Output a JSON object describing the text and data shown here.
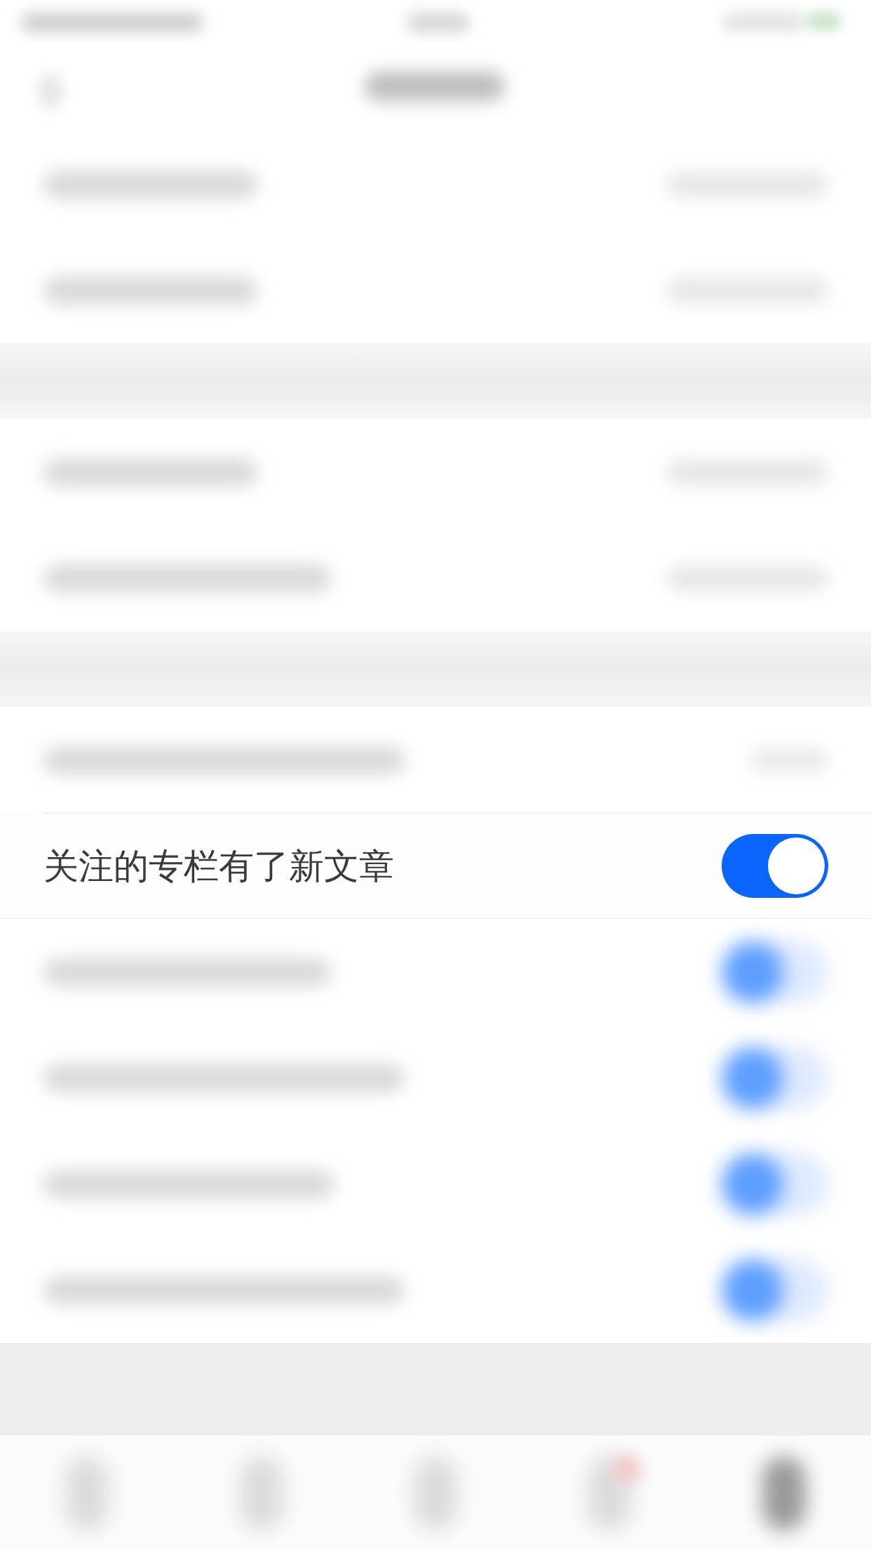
{
  "sections": [
    {
      "rows": [
        {
          "kind": "value",
          "blurred": true
        },
        {
          "kind": "value",
          "blurred": true
        }
      ]
    },
    {
      "rows": [
        {
          "kind": "value",
          "blurred": true
        },
        {
          "kind": "value",
          "blurred": true
        }
      ]
    },
    {
      "rows": [
        {
          "kind": "value",
          "blurred": true
        },
        {
          "kind": "toggle",
          "blurred": false,
          "label": "关注的专栏有了新文章",
          "on": true
        },
        {
          "kind": "toggle",
          "blurred": true,
          "on": true
        },
        {
          "kind": "toggle",
          "blurred": true,
          "on": true
        },
        {
          "kind": "toggle",
          "blurred": true,
          "on": true
        },
        {
          "kind": "toggle",
          "blurred": true,
          "on": true
        }
      ]
    }
  ],
  "tab_bar": {
    "tabs": [
      {
        "selected": false,
        "badge": false
      },
      {
        "selected": false,
        "badge": false
      },
      {
        "selected": false,
        "badge": false
      },
      {
        "selected": false,
        "badge": true
      },
      {
        "selected": true,
        "badge": false
      }
    ]
  }
}
